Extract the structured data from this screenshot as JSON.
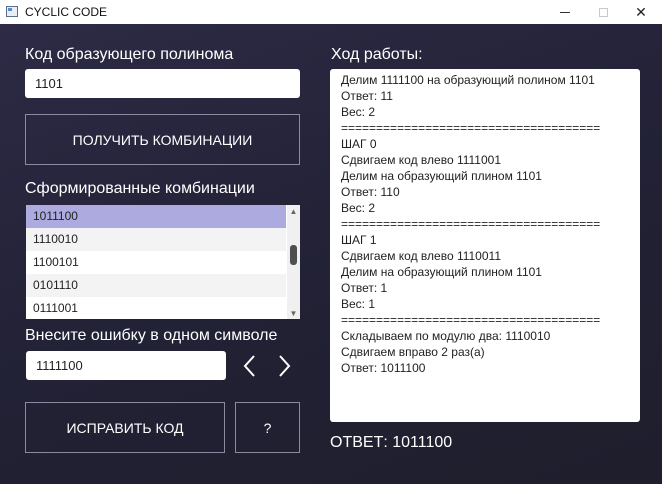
{
  "window": {
    "title": "CYCLIC CODE",
    "controls": {
      "minimize": "",
      "maximize": "",
      "close": "✕"
    }
  },
  "left": {
    "polynomial_label": "Код образующего полинома",
    "polynomial_value": "1101",
    "get_combinations_label": "ПОЛУЧИТЬ КОМБИНАЦИИ",
    "combinations_label": "Сформированные комбинации",
    "combinations": [
      "1011100",
      "1110010",
      "1100101",
      "0101110",
      "0111001"
    ],
    "selected_index": 0,
    "error_label": "Внесите ошибку в одном символе",
    "error_value": "1111100",
    "fix_label": "ИСПРАВИТЬ КОД",
    "help_label": "?"
  },
  "right": {
    "log_label": "Ход работы:",
    "log_lines": [
      "Делим 1111100 на образующий полином 1101",
      "Ответ: 11",
      "Вес: 2",
      "=====================================",
      "ШАГ 0",
      "Сдвигаем код влево 1111001",
      "Делим на образующий плином 1101",
      "Ответ: 110",
      "Вес: 2",
      "=====================================",
      "ШАГ 1",
      "Сдвигаем код влево 1110011",
      "Делим на образующий плином 1101",
      "Ответ: 1",
      "Вес: 1",
      "=====================================",
      "Складываем по модулю два: 1110010",
      "Сдвигаем вправо 2 раз(а)",
      "Ответ: 1011100"
    ],
    "answer_label": "ОТВЕТ:",
    "answer_value": "1011100"
  },
  "colors": {
    "background": "#26253a",
    "selected_item": "#acaadf",
    "text_light": "#ffffff"
  }
}
